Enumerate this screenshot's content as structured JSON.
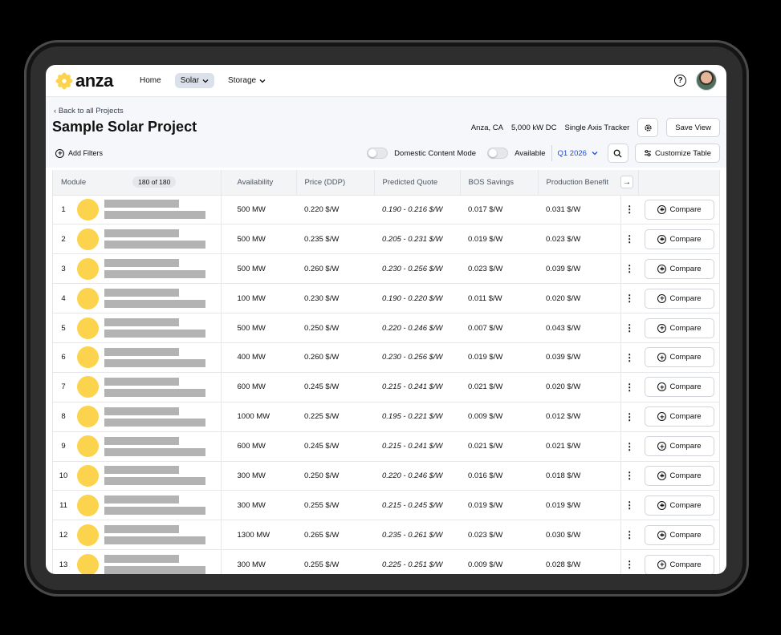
{
  "colors": {
    "accent": "#fcd34d",
    "link": "#1d4ed8",
    "bar": "#b3b3b3"
  },
  "nav": {
    "logo": "anza",
    "items": [
      {
        "label": "Home",
        "active": false,
        "dropdown": false
      },
      {
        "label": "Solar",
        "active": true,
        "dropdown": true
      },
      {
        "label": "Storage",
        "active": false,
        "dropdown": true
      }
    ]
  },
  "header": {
    "back_label": "Back to all Projects",
    "title": "Sample Solar Project",
    "location": "Anza, CA",
    "capacity": "5,000 kW DC",
    "tracker": "Single Axis Tracker",
    "save_view": "Save View"
  },
  "filters": {
    "add_filters": "Add Filters",
    "domestic_content": "Domestic Content Mode",
    "available": "Available",
    "quarter": "Q1 2026",
    "customize": "Customize Table"
  },
  "table": {
    "columns": {
      "module": "Module",
      "count": "180 of 180",
      "availability": "Availability",
      "price": "Price (DDP)",
      "predicted": "Predicted Quote",
      "bos": "BOS Savings",
      "production": "Production Benefit"
    },
    "compare_label": "Compare",
    "rows": [
      {
        "rank": "1",
        "availability": "500 MW",
        "price": "0.220 $/W",
        "quote": "0.190 - 0.216 $/W",
        "bos": "0.017 $/W",
        "prod": "0.031 $/W"
      },
      {
        "rank": "2",
        "availability": "500 MW",
        "price": "0.235 $/W",
        "quote": "0.205 - 0.231 $/W",
        "bos": "0.019 $/W",
        "prod": "0.023 $/W"
      },
      {
        "rank": "3",
        "availability": "500 MW",
        "price": "0.260 $/W",
        "quote": "0.230 - 0.256 $/W",
        "bos": "0.023 $/W",
        "prod": "0.039 $/W"
      },
      {
        "rank": "4",
        "availability": "100 MW",
        "price": "0.230 $/W",
        "quote": "0.190 - 0.220 $/W",
        "bos": "0.011 $/W",
        "prod": "0.020 $/W"
      },
      {
        "rank": "5",
        "availability": "500 MW",
        "price": "0.250 $/W",
        "quote": "0.220 - 0.246 $/W",
        "bos": "0.007 $/W",
        "prod": "0.043 $/W"
      },
      {
        "rank": "6",
        "availability": "400 MW",
        "price": "0.260 $/W",
        "quote": "0.230 - 0.256 $/W",
        "bos": "0.019 $/W",
        "prod": "0.039 $/W"
      },
      {
        "rank": "7",
        "availability": "600 MW",
        "price": "0.245 $/W",
        "quote": "0.215 - 0.241 $/W",
        "bos": "0.021 $/W",
        "prod": "0.020 $/W"
      },
      {
        "rank": "8",
        "availability": "1000 MW",
        "price": "0.225 $/W",
        "quote": "0.195 - 0.221 $/W",
        "bos": "0.009 $/W",
        "prod": "0.012 $/W"
      },
      {
        "rank": "9",
        "availability": "600 MW",
        "price": "0.245 $/W",
        "quote": "0.215 - 0.241 $/W",
        "bos": "0.021 $/W",
        "prod": "0.021 $/W"
      },
      {
        "rank": "10",
        "availability": "300 MW",
        "price": "0.250 $/W",
        "quote": "0.220 - 0.246 $/W",
        "bos": "0.016 $/W",
        "prod": "0.018 $/W"
      },
      {
        "rank": "11",
        "availability": "300 MW",
        "price": "0.255 $/W",
        "quote": "0.215 - 0.245 $/W",
        "bos": "0.019 $/W",
        "prod": "0.019 $/W"
      },
      {
        "rank": "12",
        "availability": "1300 MW",
        "price": "0.265 $/W",
        "quote": "0.235 - 0.261 $/W",
        "bos": "0.023 $/W",
        "prod": "0.030 $/W"
      },
      {
        "rank": "13",
        "availability": "300 MW",
        "price": "0.255 $/W",
        "quote": "0.225 - 0.251 $/W",
        "bos": "0.009 $/W",
        "prod": "0.028 $/W"
      }
    ]
  }
}
